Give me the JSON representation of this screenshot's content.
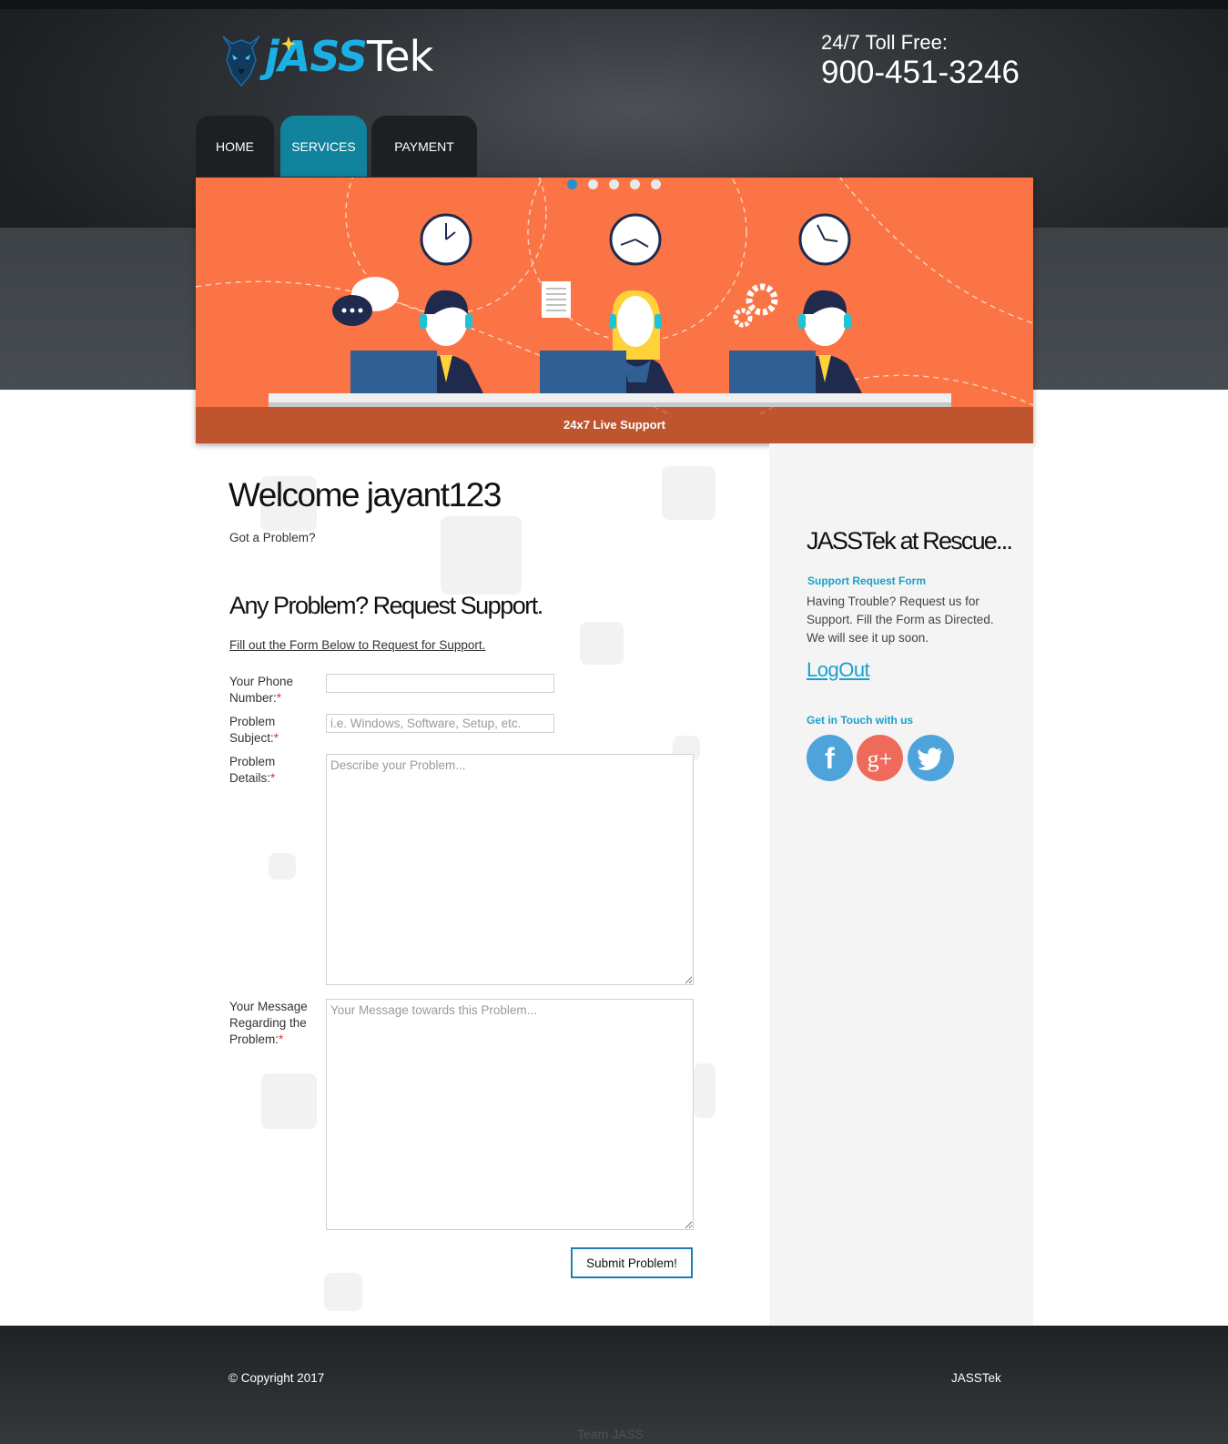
{
  "header": {
    "logo": {
      "part1": "jASS",
      "part2": "Tek"
    },
    "toll_label": "24/7 Toll Free:",
    "toll_number": "900-451-3246"
  },
  "nav": {
    "items": [
      {
        "label": "HOME"
      },
      {
        "label": "SERVICES",
        "active": true
      },
      {
        "label": "PAYMENT"
      }
    ]
  },
  "banner": {
    "caption": "24x7 Live Support",
    "slides": 5,
    "active_slide": 1,
    "bg_color": "#fb7445"
  },
  "main": {
    "welcome": "Welcome jayant123",
    "subtitle": "Got a Problem?",
    "section_title": "Any Problem? Request Support.",
    "instructions": "Fill out the Form Below to Request for Support.",
    "form": {
      "phone": {
        "label": "Your Phone Number:",
        "placeholder": ""
      },
      "subject": {
        "label": "Problem Subject:",
        "placeholder": "i.e. Windows, Software, Setup, etc."
      },
      "details": {
        "label": "Problem Details:",
        "placeholder": "Describe your Problem..."
      },
      "message": {
        "label": "Your Message Regarding the Problem:",
        "placeholder": "Your Message towards this Problem..."
      },
      "required_mark": "*",
      "submit_label": "Submit Problem!"
    }
  },
  "sidebar": {
    "title": "JASSTek at Rescue...",
    "form_heading": "Support Request Form",
    "text": "Having Trouble? Request us for Support. Fill the Form as Directed. We will see it up soon.",
    "logout": "LogOut",
    "social_heading": "Get in Touch with us",
    "social": [
      {
        "name": "facebook-icon",
        "color": "#4fa3db",
        "glyph": "f"
      },
      {
        "name": "google-plus-icon",
        "color": "#ee6b5b",
        "glyph": "g+"
      },
      {
        "name": "twitter-icon",
        "color": "#4fa3db",
        "glyph": ""
      }
    ]
  },
  "footer": {
    "copyright": "© Copyright 2017",
    "brand": "JASSTek",
    "team": "Team JASS"
  }
}
